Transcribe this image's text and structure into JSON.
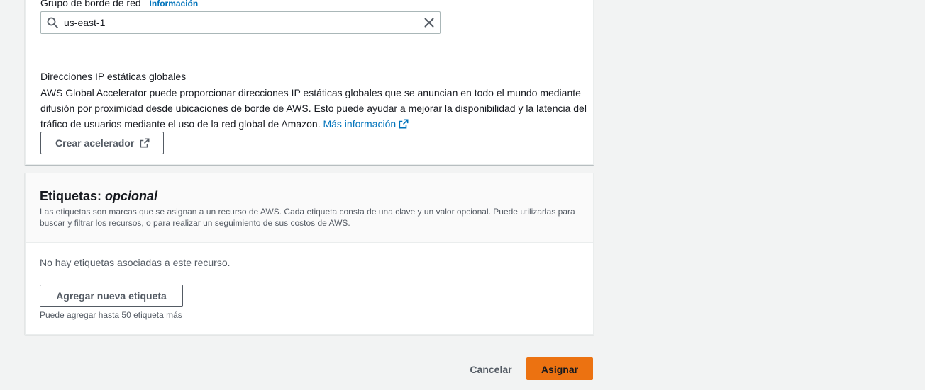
{
  "edge_group": {
    "label": "Grupo de borde de red",
    "info_link": "Información",
    "search_value": "us-east-1",
    "search_icon": "search-icon",
    "clear_icon": "close-icon"
  },
  "static_ip": {
    "title": "Direcciones IP estáticas globales",
    "description": "AWS Global Accelerator puede proporcionar direcciones IP estáticas globales que se anuncian en todo el mundo mediante difusión por proximidad desde ubicaciones de borde de AWS. Esto puede ayudar a mejorar la disponibilidad y la latencia del tráfico de usuarios mediante el uso de la red global de Amazon.",
    "more_info_link": "Más información",
    "create_button": "Crear acelerador",
    "external_icon": "external-link-icon"
  },
  "tags": {
    "title": "Etiquetas:",
    "title_optional": "opcional",
    "description": "Las etiquetas son marcas que se asignan a un recurso de AWS. Cada etiqueta consta de una clave y un valor opcional. Puede utilizarlas para buscar y filtrar los recursos, o para realizar un seguimiento de sus costos de AWS.",
    "empty_message": "No hay etiquetas asociadas a este recurso.",
    "add_button": "Agregar nueva etiqueta",
    "hint": "Puede agregar hasta 50 etiqueta más"
  },
  "footer": {
    "cancel": "Cancelar",
    "assign": "Asignar"
  },
  "colors": {
    "link": "#0073bb",
    "primary_button": "#ec7211",
    "page_background": "#f2f3f3"
  }
}
